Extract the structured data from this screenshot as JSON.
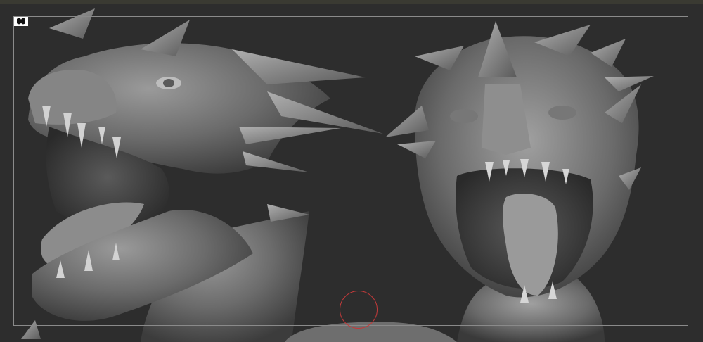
{
  "viewport": {
    "background": "#2d2d2d",
    "frame_color": "#8a8a8a",
    "brush_cursor_color": "#c43a3a",
    "model_color": "#7a7a7a"
  },
  "icons": {
    "corner": "mask-icon"
  }
}
